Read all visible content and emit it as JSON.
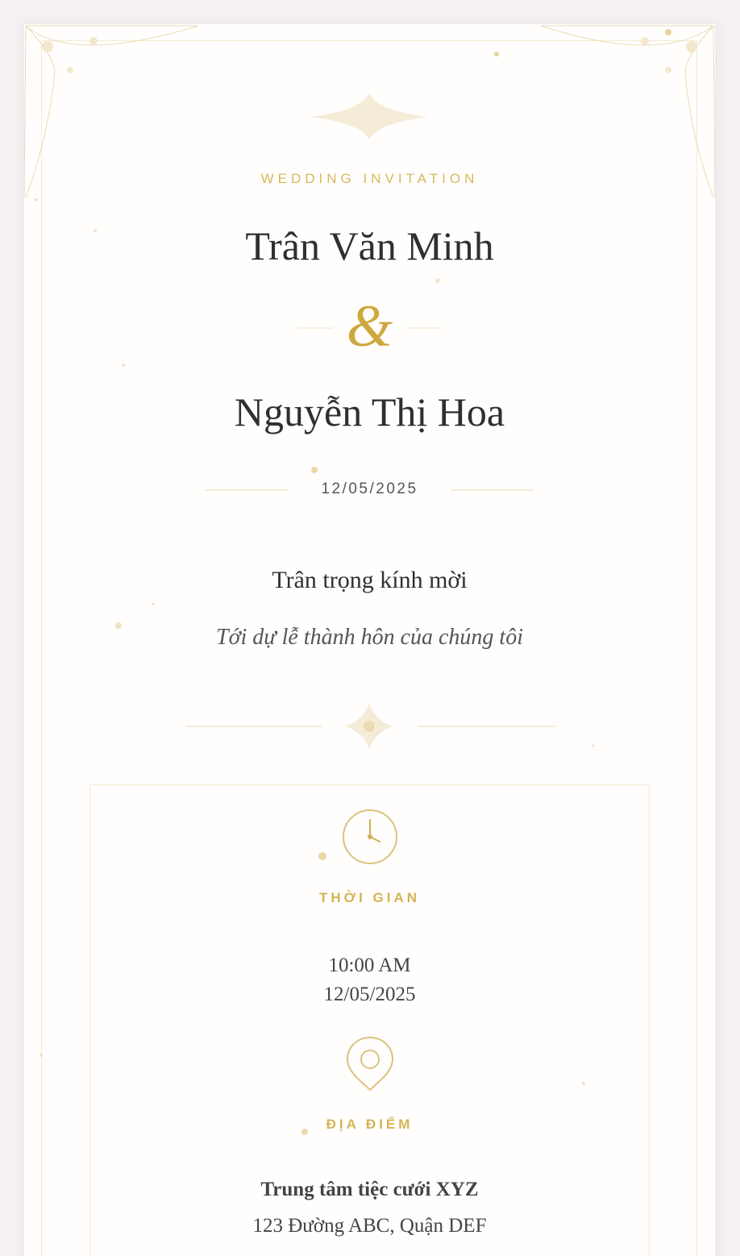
{
  "invitation": {
    "eyebrow": "WEDDING INVITATION",
    "groom_name": "Trân Văn Minh",
    "ampersand": "&",
    "bride_name": "Nguyễn Thị Hoa",
    "date": "12/05/2025",
    "invite_line": "Trân trọng kính mời",
    "invite_subline": "Tới dự lễ thành hôn của chúng tôi"
  },
  "details": {
    "time": {
      "icon": "clock-icon",
      "title": "THỜI GIAN",
      "line1": "10:00 AM",
      "line2": "12/05/2025"
    },
    "location": {
      "icon": "location-pin-icon",
      "title": "ĐỊA ĐIỂM",
      "venue": "Trung tâm tiệc cưới XYZ",
      "address": "123 Đường ABC, Quận DEF"
    }
  },
  "colors": {
    "page_background": "#f6f1f4",
    "card_background": "#fffefd",
    "gold": "#d4b453",
    "gold_light": "#f5ecd8",
    "text_dark": "#2f2f2f",
    "text_muted": "#555555"
  }
}
